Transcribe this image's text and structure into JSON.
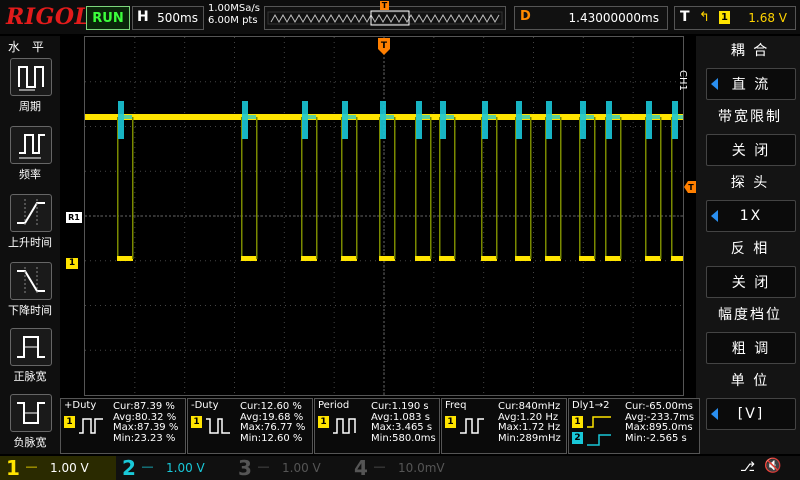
{
  "header": {
    "brand": "RIGOL",
    "run_state": "RUN",
    "timebase_label": "H",
    "timebase_value": "500ms",
    "sample_rate": "1.00MSa/s",
    "memory_depth": "6.00M pts",
    "trigger_marker": "T",
    "delay_label": "D",
    "delay_value": "1.43000000ms",
    "trigger_label": "T",
    "trigger_channel": "1",
    "trigger_level": "1.68 V"
  },
  "left_panel": {
    "title": "水 平",
    "buttons": [
      {
        "label": "周期"
      },
      {
        "label": "频率"
      },
      {
        "label": "上升时间"
      },
      {
        "label": "下降时间"
      },
      {
        "label": "正脉宽"
      },
      {
        "label": "负脉宽"
      }
    ]
  },
  "right_panel": {
    "channel_tag": "CH1",
    "menu": [
      {
        "title": "耦 合",
        "value": "直 流",
        "arrow": true
      },
      {
        "title": "带宽限制",
        "value": "关 闭",
        "arrow": false
      },
      {
        "title": "探 头",
        "value": "1X",
        "arrow": true
      },
      {
        "title": "反 相",
        "value": "关 闭",
        "arrow": false
      },
      {
        "title": "幅度档位",
        "value": "粗 调",
        "arrow": false
      },
      {
        "title": "单 位",
        "value": "[V]",
        "arrow": true
      }
    ]
  },
  "markers": {
    "ref_marker": "R1",
    "ch1_marker": "1"
  },
  "measurements": [
    {
      "title": "+Duty",
      "cur": "Cur:87.39 %",
      "avg": "Avg:80.32 %",
      "max": "Max:87.39 %",
      "min": "Min:23.23 %",
      "ch": "1"
    },
    {
      "title": "-Duty",
      "cur": "Cur:12.60 %",
      "avg": "Avg:19.68 %",
      "max": "Max:76.77 %",
      "min": "Min:12.60 %",
      "ch": "1"
    },
    {
      "title": "Period",
      "cur": "Cur:1.190 s",
      "avg": "Avg:1.083 s",
      "max": "Max:3.465 s",
      "min": "Min:580.0ms",
      "ch": "1"
    },
    {
      "title": "Freq",
      "cur": "Cur:840mHz",
      "avg": "Avg:1.20 Hz",
      "max": "Max:1.72 Hz",
      "min": "Min:289mHz",
      "ch": "1"
    },
    {
      "title": "Dly1→2",
      "cur": "Cur:-65.00ms",
      "avg": "Avg:-233.7ms",
      "max": "Max:895.0ms",
      "min": "Min:-2.565 s",
      "ch": "1",
      "ch2": "2"
    }
  ],
  "channels": [
    {
      "num": "1",
      "scale": "1.00 V",
      "color": "#ffe400",
      "active": true
    },
    {
      "num": "2",
      "scale": "1.00 V",
      "color": "#19c8d8",
      "active": false
    },
    {
      "num": "3",
      "scale": "1.00 V",
      "color": "#555555",
      "active": false
    },
    {
      "num": "4",
      "scale": "10.0mV",
      "color": "#555555",
      "active": false
    }
  ],
  "colors": {
    "ch1": "#ffe400",
    "ch2": "#19c8d8",
    "trigger": "#ff7f00",
    "brand": "#e31b1b"
  }
}
